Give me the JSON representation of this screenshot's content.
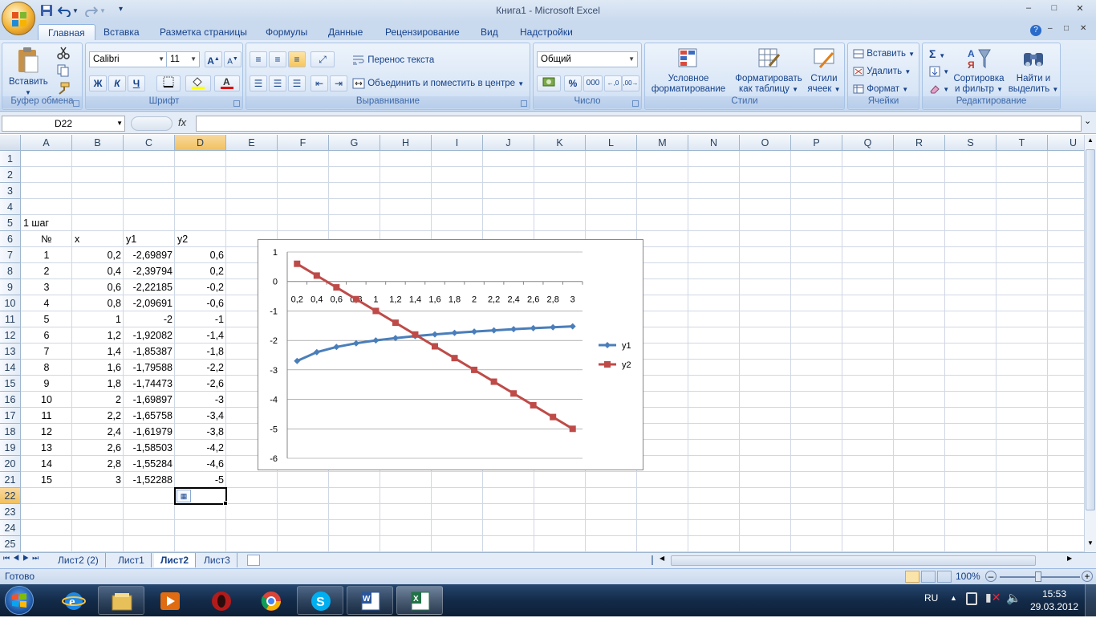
{
  "app": {
    "title": "Книга1  -  Microsoft Excel"
  },
  "window_buttons": {
    "minimize": "–",
    "maximize": "□",
    "close": "✕"
  },
  "ribbon_tabs": [
    "Главная",
    "Вставка",
    "Разметка страницы",
    "Формулы",
    "Данные",
    "Рецензирование",
    "Вид",
    "Надстройки"
  ],
  "ribbon": {
    "clipboard": {
      "label": "Буфер обмена",
      "paste": "Вставить"
    },
    "font": {
      "label": "Шрифт",
      "family": "Calibri",
      "size": "11",
      "bold": "Ж",
      "italic": "К",
      "underline": "Ч",
      "grow": "A",
      "shrink": "A"
    },
    "alignment": {
      "label": "Выравнивание",
      "wrap": "Перенос текста",
      "merge": "Объединить и поместить в центре"
    },
    "number": {
      "label": "Число",
      "format": "Общий",
      "percent": "%",
      "thousands": "000"
    },
    "styles": {
      "label": "Стили",
      "conditional": "Условное",
      "conditional2": "форматирование",
      "table": "Форматировать",
      "table2": "как таблицу",
      "cell": "Стили",
      "cell2": "ячеек"
    },
    "cells": {
      "label": "Ячейки",
      "insert": "Вставить",
      "delete": "Удалить",
      "format": "Формат"
    },
    "editing": {
      "label": "Редактирование",
      "sort": "Сортировка",
      "sort2": "и фильтр",
      "find": "Найти и",
      "find2": "выделить"
    }
  },
  "formula_bar": {
    "name_box": "D22",
    "fx": "fx",
    "formula": ""
  },
  "columns": [
    "A",
    "B",
    "C",
    "D",
    "E",
    "F",
    "G",
    "H",
    "I",
    "J",
    "K",
    "L",
    "M",
    "N",
    "O",
    "P",
    "Q",
    "R",
    "S",
    "T",
    "U"
  ],
  "rows": [
    "1",
    "2",
    "3",
    "4",
    "5",
    "6",
    "7",
    "8",
    "9",
    "10",
    "11",
    "12",
    "13",
    "14",
    "15",
    "16",
    "17",
    "18",
    "19",
    "20",
    "21",
    "22",
    "23",
    "24",
    "25"
  ],
  "cells": {
    "step_label": "1 шаг",
    "headers": [
      "№",
      "x",
      "y1",
      "y2"
    ],
    "table": [
      [
        "1",
        "0,2",
        "-2,69897",
        "0,6"
      ],
      [
        "2",
        "0,4",
        "-2,39794",
        "0,2"
      ],
      [
        "3",
        "0,6",
        "-2,22185",
        "-0,2"
      ],
      [
        "4",
        "0,8",
        "-2,09691",
        "-0,6"
      ],
      [
        "5",
        "1",
        "-2",
        "-1"
      ],
      [
        "6",
        "1,2",
        "-1,92082",
        "-1,4"
      ],
      [
        "7",
        "1,4",
        "-1,85387",
        "-1,8"
      ],
      [
        "8",
        "1,6",
        "-1,79588",
        "-2,2"
      ],
      [
        "9",
        "1,8",
        "-1,74473",
        "-2,6"
      ],
      [
        "10",
        "2",
        "-1,69897",
        "-3"
      ],
      [
        "11",
        "2,2",
        "-1,65758",
        "-3,4"
      ],
      [
        "12",
        "2,4",
        "-1,61979",
        "-3,8"
      ],
      [
        "13",
        "2,6",
        "-1,58503",
        "-4,2"
      ],
      [
        "14",
        "2,8",
        "-1,55284",
        "-4,6"
      ],
      [
        "15",
        "3",
        "-1,52288",
        "-5"
      ]
    ]
  },
  "chart_data": {
    "type": "line",
    "categories": [
      "0,2",
      "0,4",
      "0,6",
      "0,8",
      "1",
      "1,2",
      "1,4",
      "1,6",
      "1,8",
      "2",
      "2,2",
      "2,4",
      "2,6",
      "2,8",
      "3"
    ],
    "series": [
      {
        "name": "y1",
        "values": [
          -2.69897,
          -2.39794,
          -2.22185,
          -2.09691,
          -2,
          -1.92082,
          -1.85387,
          -1.79588,
          -1.74473,
          -1.69897,
          -1.65758,
          -1.61979,
          -1.58503,
          -1.55284,
          -1.52288
        ],
        "color": "#4a7ebb",
        "marker": "diamond"
      },
      {
        "name": "y2",
        "values": [
          0.6,
          0.2,
          -0.2,
          -0.6,
          -1,
          -1.4,
          -1.8,
          -2.2,
          -2.6,
          -3,
          -3.4,
          -3.8,
          -4.2,
          -4.6,
          -5
        ],
        "color": "#be4b48",
        "marker": "square"
      }
    ],
    "yticks": [
      "1",
      "0",
      "-1",
      "-2",
      "-3",
      "-4",
      "-5",
      "-6"
    ],
    "ylim": [
      -6,
      1
    ],
    "grid": true,
    "legend": "right"
  },
  "sheet_tabs": [
    "Лист2 (2)",
    "Лист1",
    "Лист2",
    "Лист3"
  ],
  "active_sheet": "Лист2",
  "status": {
    "ready": "Готово",
    "zoom": "100%"
  },
  "taskbar": {
    "lang": "RU",
    "time": "15:53",
    "date": "29.03.2012"
  }
}
